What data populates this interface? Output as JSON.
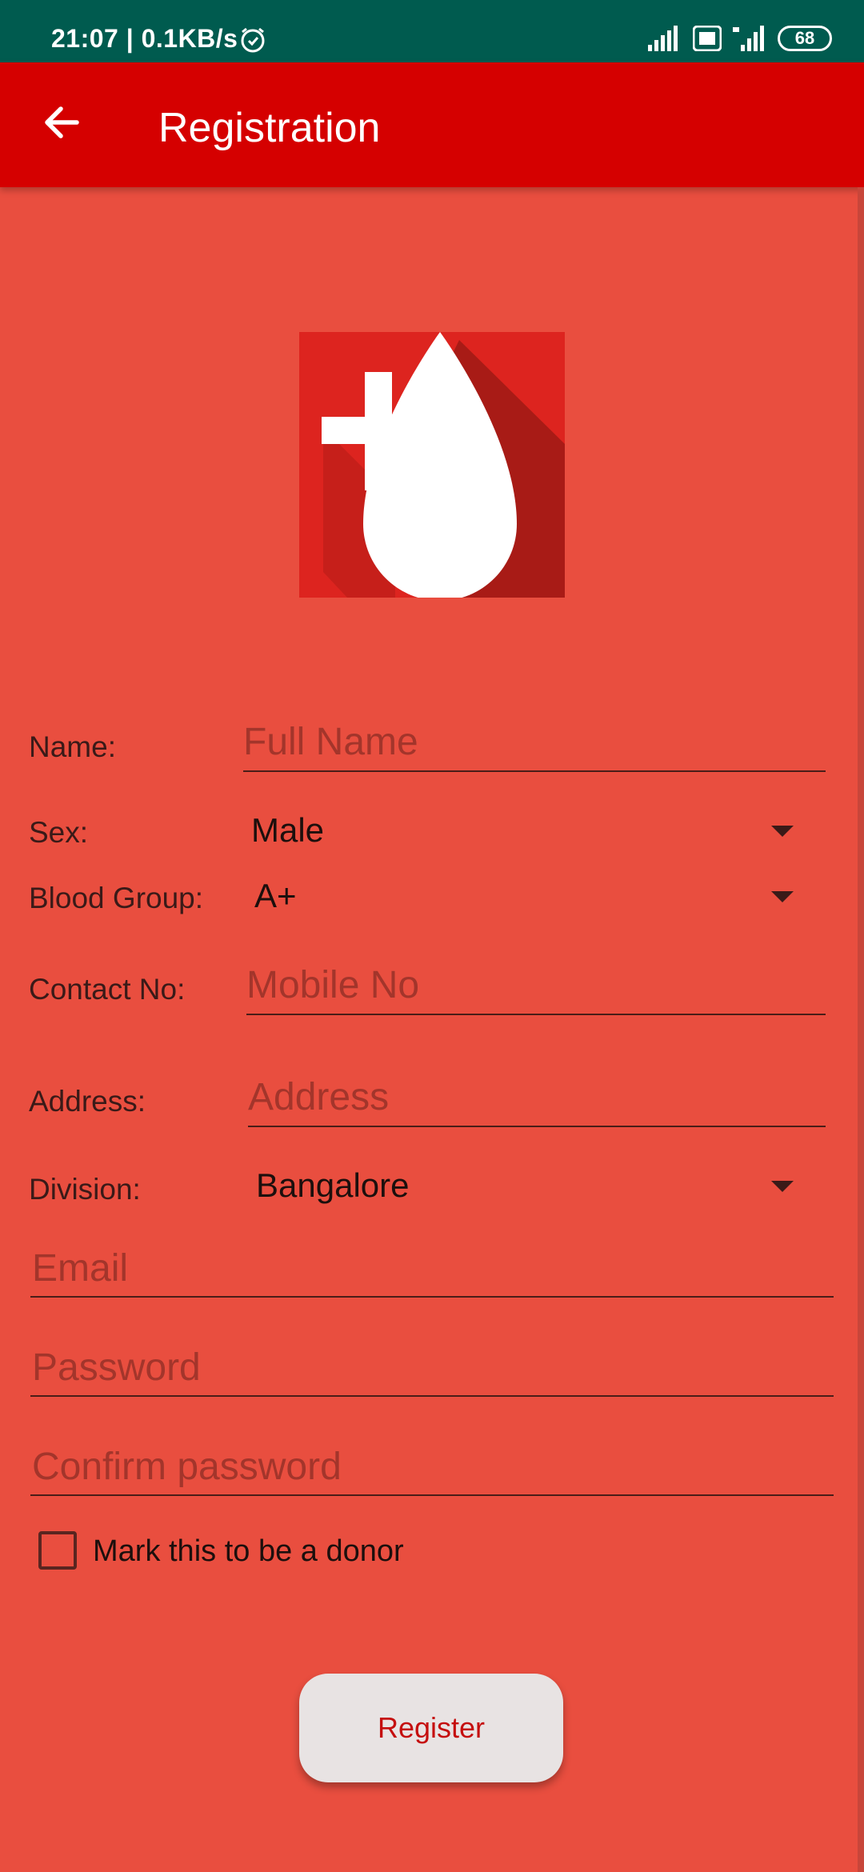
{
  "status_bar": {
    "time": "21:07 | 0.1KB/s",
    "battery": "68"
  },
  "app_bar": {
    "title": "Registration"
  },
  "form": {
    "name": {
      "label": "Name:",
      "placeholder": "Full Name"
    },
    "sex": {
      "label": "Sex:",
      "value": "Male"
    },
    "blood_group": {
      "label": "Blood Group:",
      "value": "A+"
    },
    "contact": {
      "label": "Contact No:",
      "placeholder": "Mobile No"
    },
    "address": {
      "label": "Address:",
      "placeholder": "Address"
    },
    "division": {
      "label": "Division:",
      "value": "Bangalore"
    },
    "email": {
      "placeholder": "Email"
    },
    "password": {
      "placeholder": "Password"
    },
    "confirm_password": {
      "placeholder": "Confirm password"
    },
    "donor_checkbox": {
      "label": "Mark this to be a donor",
      "checked": false
    },
    "register_button": "Register"
  },
  "colors": {
    "status_bar": "#005b4f",
    "app_bar": "#d50000",
    "background": "#e94e3f",
    "button": "#e8e3e3",
    "button_text": "#c50f0f"
  }
}
